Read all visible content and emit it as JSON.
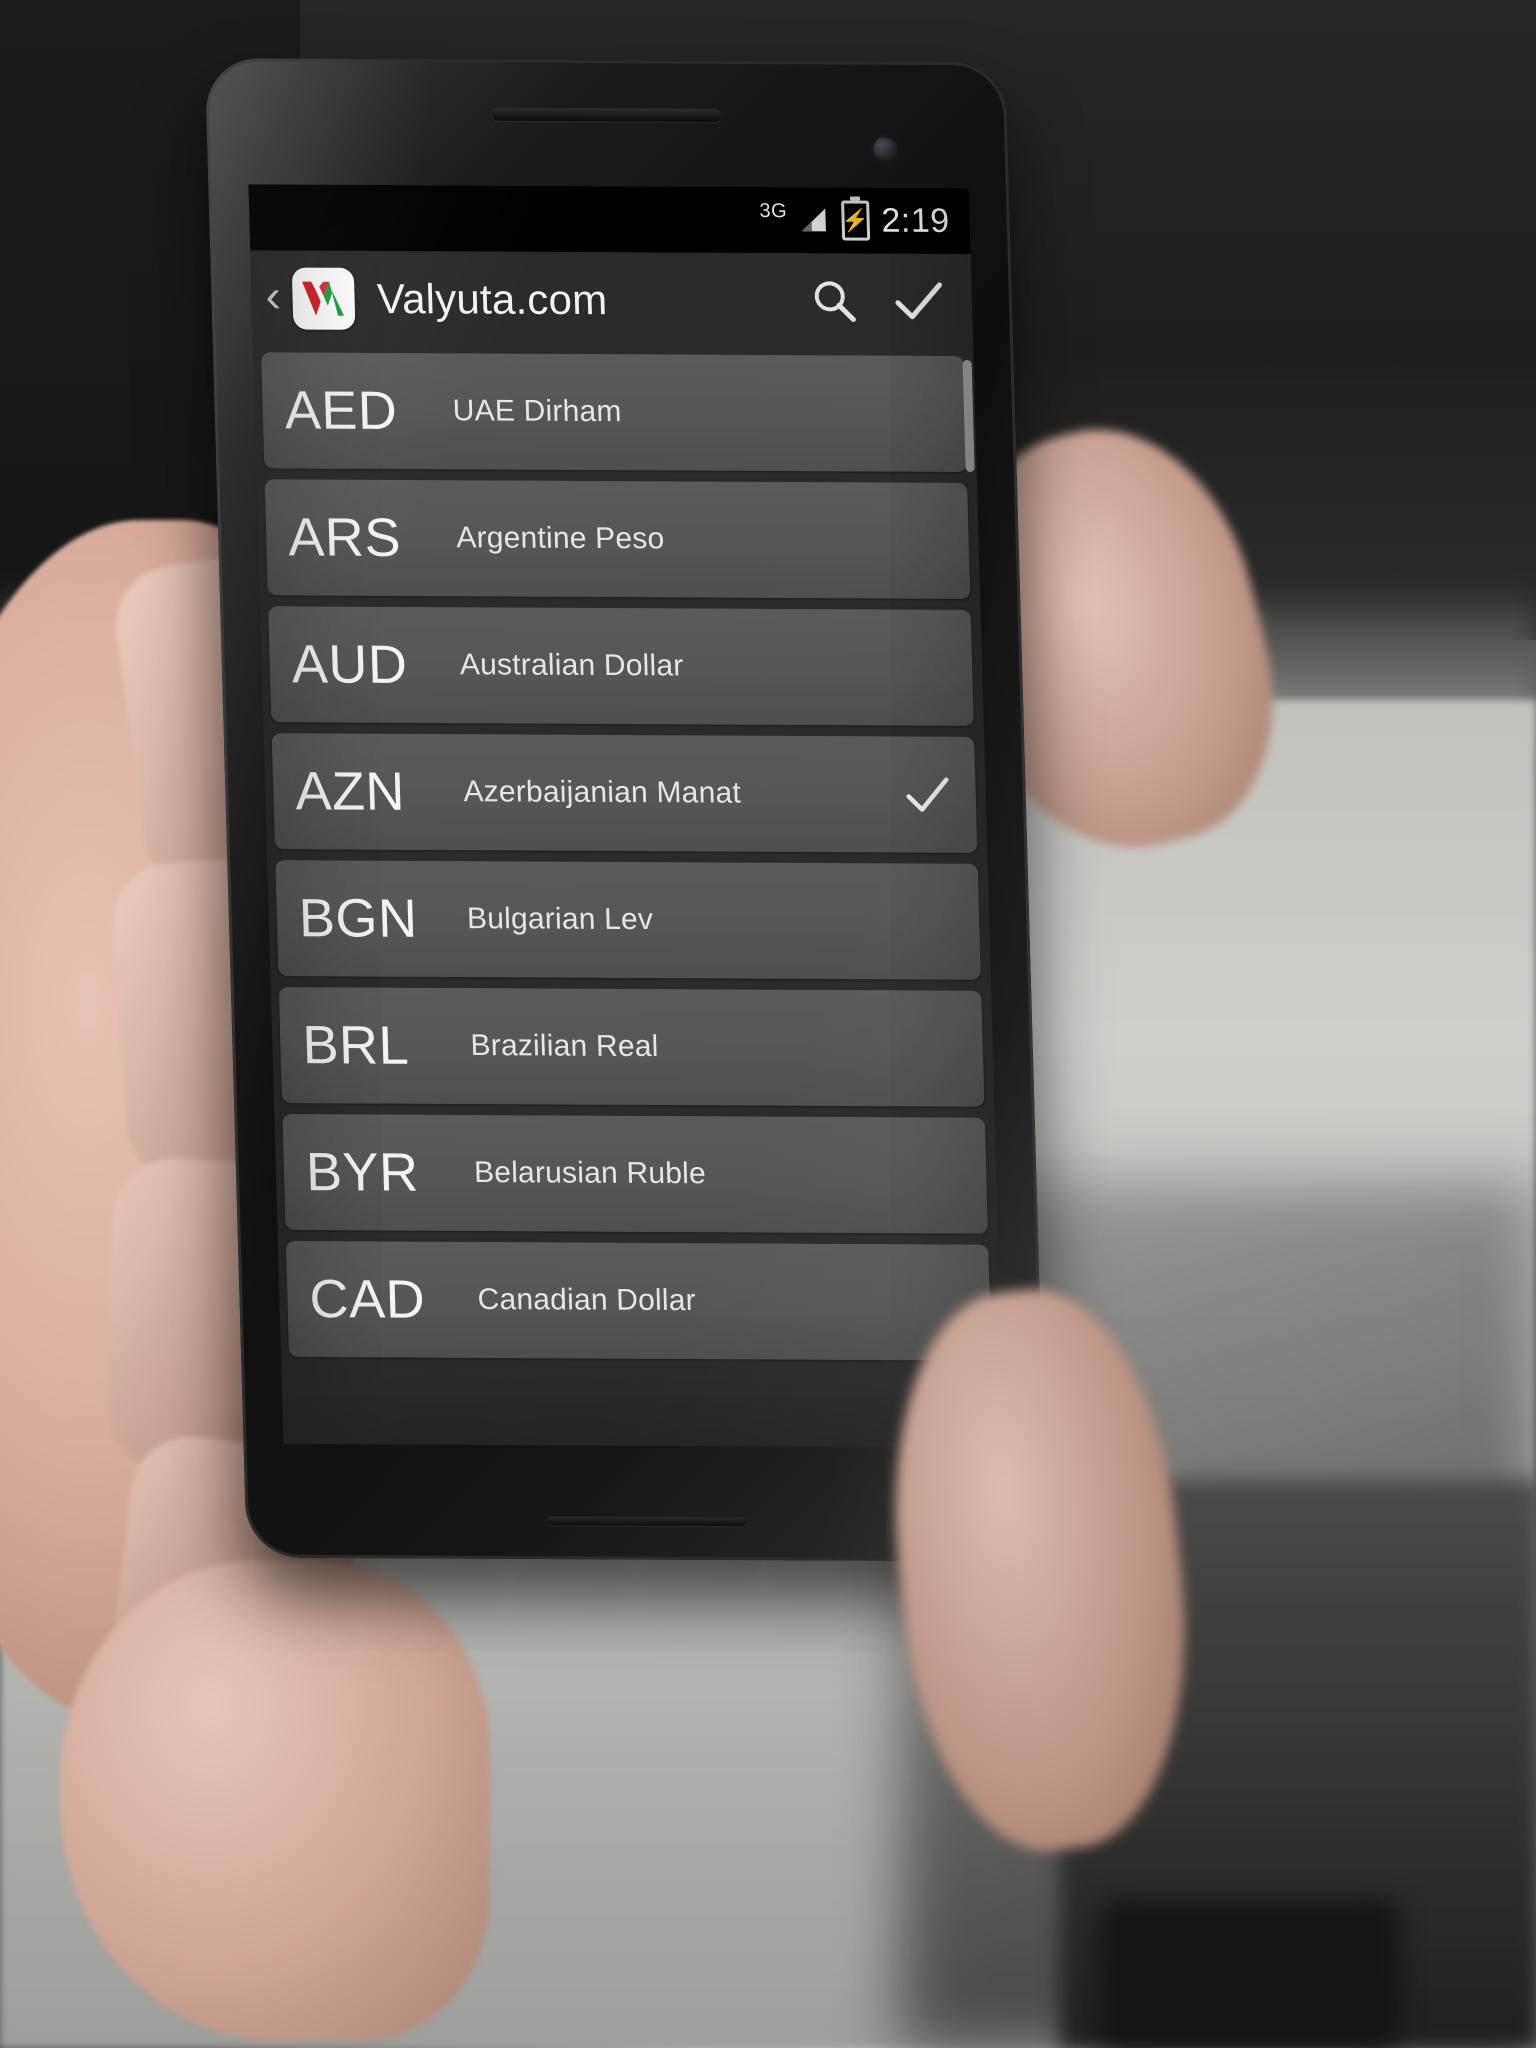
{
  "device": {
    "platform": "Android",
    "orientation": "portrait"
  },
  "status_bar": {
    "network_label": "3G",
    "signal_icon": "signal-bars-icon",
    "battery_icon": "battery-charging-icon",
    "battery_bolt": "⚡",
    "clock": "2:19"
  },
  "action_bar": {
    "back_icon": "‹",
    "app_logo_icon": "valyuta-logo-icon",
    "logo_letters": {
      "left": "V",
      "right": "A",
      "left_color": "#cc2027",
      "right_color": "#1f9e3e"
    },
    "title": "Valyuta.com",
    "search_icon": "search-icon",
    "confirm_icon": "checkmark-icon"
  },
  "currency_list": {
    "selected_code": "AZN",
    "check_glyph": "✓",
    "items": [
      {
        "code": "AED",
        "name": "UAE Dirham",
        "checked": false
      },
      {
        "code": "ARS",
        "name": "Argentine Peso",
        "checked": false
      },
      {
        "code": "AUD",
        "name": "Australian Dollar",
        "checked": false
      },
      {
        "code": "AZN",
        "name": "Azerbaijanian Manat",
        "checked": true
      },
      {
        "code": "BGN",
        "name": "Bulgarian Lev",
        "checked": false
      },
      {
        "code": "BRL",
        "name": "Brazilian Real",
        "checked": false
      },
      {
        "code": "BYR",
        "name": "Belarusian Ruble",
        "checked": false
      },
      {
        "code": "CAD",
        "name": "Canadian Dollar",
        "checked": false
      }
    ]
  },
  "nav_bar": {
    "back_icon": "nav-back-triangle-icon",
    "home_icon": "nav-home-circle-icon",
    "recents_icon": "nav-recents-square-icon"
  },
  "colors": {
    "screen_bg": "#2b2b2b",
    "row_bg": "#565656",
    "text_primary": "#f4f4f4",
    "text_secondary": "#e6e6e6",
    "status_bg": "#000000",
    "logo_red": "#cc2027",
    "logo_green": "#1f9e3e"
  }
}
